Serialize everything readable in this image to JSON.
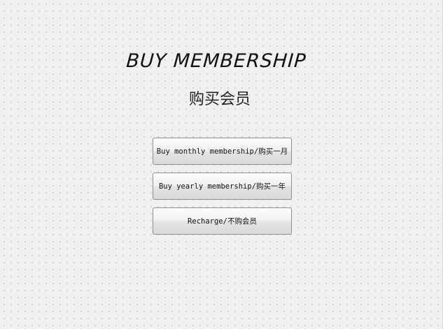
{
  "header": {
    "title_en": "BUY MEMBERSHIP",
    "title_cn": "购买会员"
  },
  "actions": {
    "monthly_label": "Buy monthly membership/购买一月",
    "yearly_label": "Buy yearly membership/购买一年",
    "recharge_label": "Recharge/不购会员"
  }
}
